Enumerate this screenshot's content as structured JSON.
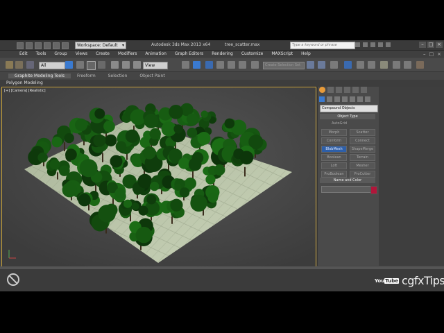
{
  "titlebar": {
    "app_logo": "S",
    "workspace": "Workspace: Default",
    "title": "Autodesk 3ds Max 2013 x64",
    "file": "tree_scatter.max",
    "search_placeholder": "Type a keyword or phrase"
  },
  "menu": {
    "items": [
      "Edit",
      "Tools",
      "Group",
      "Views",
      "Create",
      "Modifiers",
      "Animation",
      "Graph Editors",
      "Rendering",
      "Customize",
      "MAXScript",
      "Help"
    ]
  },
  "toolbar": {
    "selection_filter": "All",
    "reference_coord": "View",
    "named_selection_sets": "Create Selection Set"
  },
  "ribbon": {
    "tabs": [
      "Graphite Modeling Tools",
      "Freeform",
      "Selection",
      "Object Paint"
    ],
    "sub_label": "Polygon Modeling"
  },
  "viewport": {
    "label": "[+] [Camera] [Realistic]",
    "watermark": "cgfxTips"
  },
  "command_panel": {
    "category": "Compound Objects",
    "object_type_header": "Object Type",
    "autogrid": "AutoGrid",
    "buttons": [
      "Morph",
      "Scatter",
      "Conform",
      "Connect",
      "BlobMesh",
      "ShapeMerge",
      "Boolean",
      "Terrain",
      "Loft",
      "Mesher",
      "ProBoolean",
      "ProCutter"
    ],
    "active_button": "BlobMesh",
    "name_color_header": "Name and Color",
    "object_color": "#b0163a"
  },
  "branding": {
    "youtube": "You",
    "youtube_tube": "Tube",
    "channel": "cgfxTips"
  }
}
